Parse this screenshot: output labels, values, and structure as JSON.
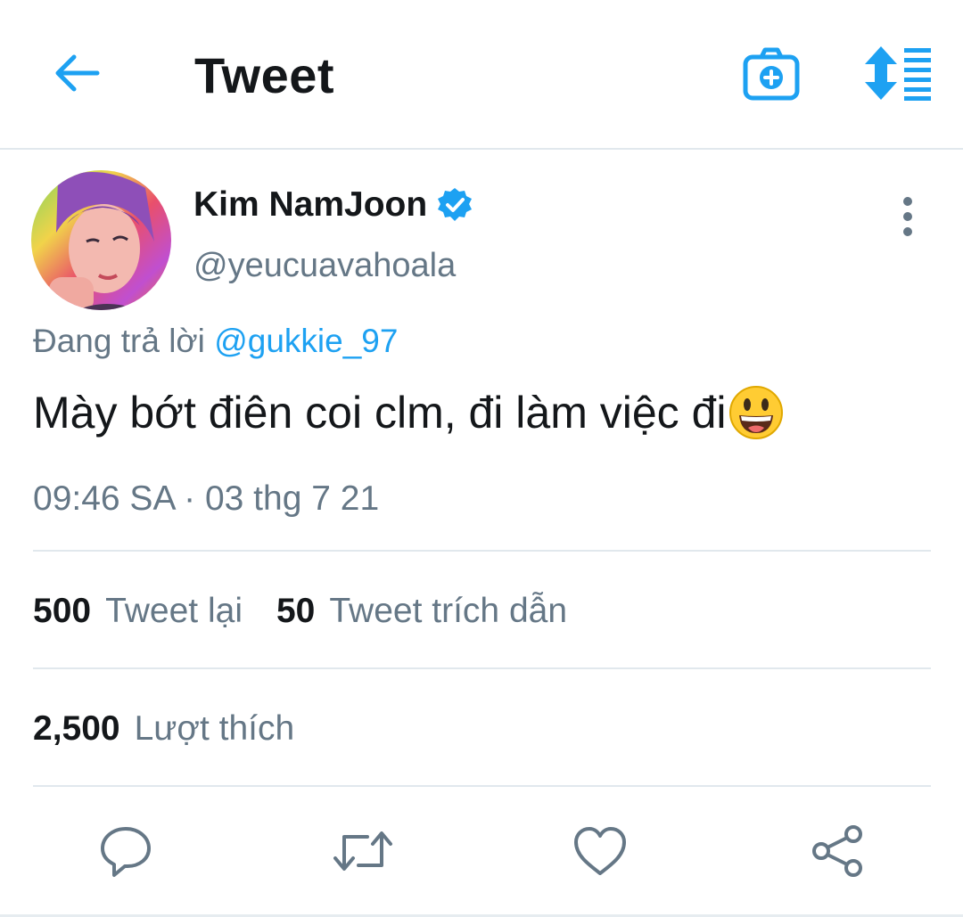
{
  "header": {
    "title": "Tweet",
    "icons": {
      "back": "arrow-left-icon",
      "camera": "camera-add-icon",
      "sort": "sort-icon"
    },
    "accent": "#1da1f2"
  },
  "tweet": {
    "author": {
      "name": "Kim NamJoon",
      "handle": "@yeucuavahoala",
      "verified": true
    },
    "reply": {
      "prefix": "Đang trả lời",
      "to": "@gukkie_97"
    },
    "text": "Mày bớt điên coi clm, đi làm việc đi",
    "emoji": "smiley-face",
    "timestamp": "09:46 SA · 03 thg 7 21",
    "stats": {
      "retweets_count": "500",
      "retweets_label": "Tweet lại",
      "quotes_count": "50",
      "quotes_label": "Tweet trích dẫn",
      "likes_count": "2,500",
      "likes_label": "Lượt thích"
    }
  },
  "actions": [
    "reply-icon",
    "retweet-icon",
    "like-icon",
    "share-icon"
  ]
}
